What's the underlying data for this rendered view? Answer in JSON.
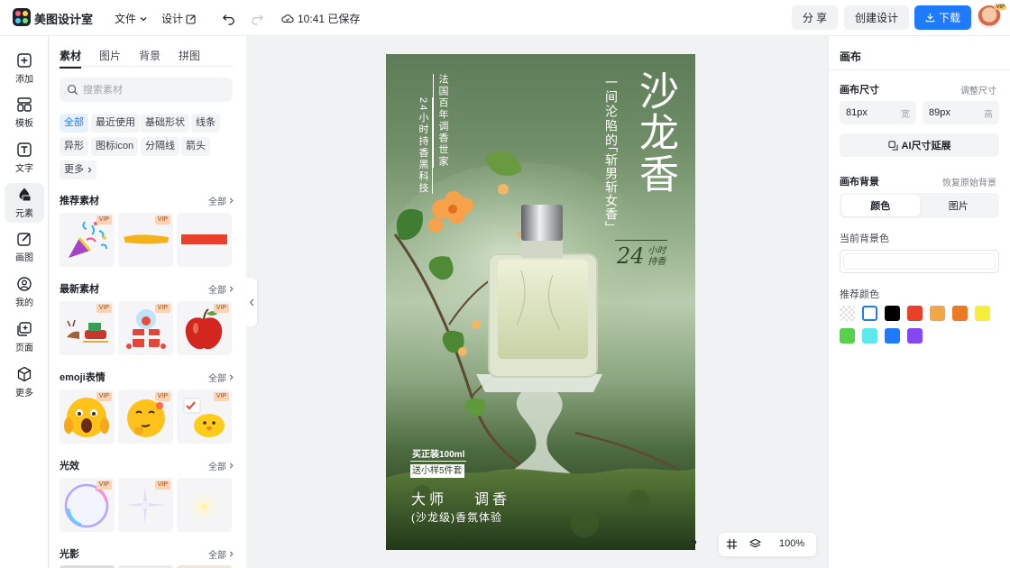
{
  "app": {
    "name": "美图设计室"
  },
  "topbar": {
    "file_label": "文件",
    "design_label": "设计",
    "save_status": "10:41 已保存",
    "share_label": "分 享",
    "create_label": "创建设计",
    "download_label": "下载",
    "avatar_badge": "VIP"
  },
  "rail": {
    "items": [
      {
        "label": "添加",
        "icon": "plus-square-icon"
      },
      {
        "label": "模板",
        "icon": "template-icon"
      },
      {
        "label": "文字",
        "icon": "text-icon"
      },
      {
        "label": "元素",
        "icon": "shapes-icon"
      },
      {
        "label": "画图",
        "icon": "draw-icon"
      },
      {
        "label": "我的",
        "icon": "user-icon"
      },
      {
        "label": "页面",
        "icon": "page-icon"
      },
      {
        "label": "更多",
        "icon": "cube-icon"
      }
    ],
    "active_index": 3
  },
  "panel": {
    "tabs": [
      "素材",
      "图片",
      "背景",
      "拼图"
    ],
    "active_tab": 0,
    "search_placeholder": "搜索素材",
    "chips": [
      "全部",
      "最近使用",
      "基础形状",
      "线条",
      "异形",
      "图标icon",
      "分隔线",
      "箭头",
      "更多"
    ],
    "vip_label": "VIP",
    "sections": [
      {
        "title": "推荐素材",
        "all_label": "全部"
      },
      {
        "title": "最新素材",
        "all_label": "全部"
      },
      {
        "title": "emoji表情",
        "all_label": "全部"
      },
      {
        "title": "光效",
        "all_label": "全部"
      },
      {
        "title": "光影",
        "all_label": "全部"
      }
    ]
  },
  "poster": {
    "vertical_line_1": "法国百年调香世家",
    "vertical_line_2": "24小时持香黑科技",
    "tagline_1": "一间沦陷的",
    "tagline_2": "「斩男斩女香」",
    "headline": "沙龙香",
    "badge_number": "24",
    "badge_top": "小时",
    "badge_bottom": "持香",
    "promo_1": "买正装100ml",
    "promo_2": "送小样5件套",
    "line_master_a": "大师",
    "line_master_b": "调香",
    "line_experience": "(沙龙级)香氛体验"
  },
  "canvas_tools": {
    "help_label": "?",
    "zoom": "100%"
  },
  "rpanel": {
    "title": "画布",
    "size_label": "画布尺寸",
    "adjust_label": "调整尺寸",
    "width_value": "81px",
    "width_unit": "宽",
    "height_value": "89px",
    "height_unit": "高",
    "extend_label": "AI尺寸延展",
    "bg_label": "画布背景",
    "restore_label": "恢复原始背景",
    "seg_color": "颜色",
    "seg_image": "图片",
    "current_bg_label": "当前背景色",
    "recommend_label": "推荐颜色",
    "swatches": [
      "transparent",
      "#ffffff",
      "#000000",
      "#e8402b",
      "#f2a64a",
      "#ec7a25",
      "#f6ec3a",
      "#56d24a",
      "#5de9e9",
      "#1f7aff",
      "#8547f2"
    ]
  }
}
